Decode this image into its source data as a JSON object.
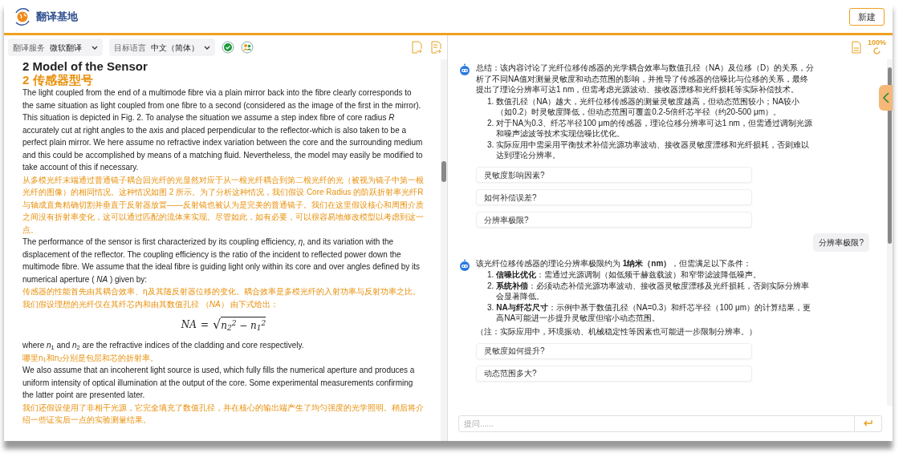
{
  "header": {
    "app_name": "翻译基地",
    "new_button": "新建"
  },
  "toolbar": {
    "selects": [
      {
        "label": "翻译服务",
        "value": "微软翻译"
      },
      {
        "label": "目标语言",
        "value": "中文（简体）"
      }
    ]
  },
  "document": {
    "blocks": [
      {
        "kind": "heading_source",
        "text": "2 Model of the Sensor"
      },
      {
        "kind": "heading_translation",
        "text": "2 传感器型号"
      },
      {
        "kind": "source",
        "text": "The light coupled from the end of a multimode fibre via a plain mirror back into the fibre clearly corresponds to the same situation as light coupled from one fibre to a second (considered as the image of the first in the mirror). This situation is depicted in Fig. 2. To analyse the situation we assume a step index fibre of core radius *R* accurately cut at right angles to the axis and placed perpendicular to the reflector-which is also taken to be a perfect plain mirror. We here assume no refractive index variation between the core and the surrounding medium and this could be accomplished by means of a matching fluid. Nevertheless, the model may easily be modified to take account of this if necessary."
      },
      {
        "kind": "translation",
        "text": "从多模光纤末端通过普通镜子耦合回光纤的光显然对应于从一根光纤耦合到第二根光纤的光（被视为镜子中第一根光纤的图像）的相同情况。这种情况如图 2 所示。为了分析这种情况，我们假设 Core Radius 的阶跃折射率光纤R与轴成直角精确切割并垂直于反射器放置——反射镜也被认为是完美的普通镜子。我们在这里假设核心和周围介质之间没有折射率变化，这可以通过匹配的流体来实现。尽管如此，如有必要，可以很容易地修改模型以考虑到这一点。"
      },
      {
        "kind": "source",
        "text": "The performance of the sensor is first characterized by its coupling efficiency, *η*, and its variation with the displacement of the reflector. The coupling efficiency is the ratio of the incident to reflected power down the multimode fibre. We assume that the ideal fibre is guiding light only within its core and over angles defined by its numerical aperture ( *NA* ) given by:"
      },
      {
        "kind": "translation",
        "text": "传感器的性能首先由其耦合效率、η及其随反射器位移的变化。耦合效率是多模光纤的入射功率与反射功率之比。我们假设理想的光纤仅在其纤芯内和由其数值孔径 （*NA*） 由下式给出："
      },
      {
        "kind": "formula",
        "lhs": "NA",
        "op": "=",
        "radical": "√",
        "radicand": "n$_{2}$$^{2}$ − n$_{1}$$^{2}$"
      },
      {
        "kind": "source",
        "text": "where *n*$_{1}$ and *n*$_{2}$ are the refractive indices of the cladding and core respectively."
      },
      {
        "kind": "translation",
        "text": "哪里n$_{1}$和n$_{2}$分别是包层和芯的折射率。"
      },
      {
        "kind": "source",
        "text": "We also assume that an incoherent light source is used, which fully fills the numerical aperture and produces a uniform intensity of optical illumination at the output of the core. Some experimental measurements confirming the latter point are presented later."
      },
      {
        "kind": "translation",
        "text": "我们还假设使用了非相干光源，它完全填充了数值孔径，并在核心的输出端产生了均匀强度的光学照明。稍后将介绍一些证实后一点的实验测量结果。"
      }
    ]
  },
  "chat": {
    "zoom": "100%",
    "messages": [
      {
        "kind": "bot",
        "intro": "总结：该内容讨论了光纤位移传感器的光学耦合效率与数值孔径（NA）及位移（D）的关系，分析了不同NA值对测量灵敏度和动态范围的影响，并推导了传感器的信噪比与位移的关系，最终提出了理论分辨率可达1 nm，但需考虑光源波动、接收器漂移和光纤损耗等实际补偿技术。",
        "items": [
          {
            "number": "1.",
            "text": "数值孔径（NA）越大，光纤位移传感器的测量灵敏度越高，但动态范围较小；NA较小（如0.2）时灵敏度降低，但动态范围可覆盖0.2-5倍纤芯半径（约20-500 μm）。"
          },
          {
            "number": "2.",
            "text": "对于NA为0.3、纤芯半径100 μm的传感器，理论位移分辨率可达1 nm，但需通过调制光源和噪声滤波等技术实现信噪比优化。"
          },
          {
            "number": "3.",
            "text": "实际应用中需采用平衡技术补偿光源功率波动、接收器灵敏度漂移和光纤损耗，否则难以达到理论分辨率。"
          }
        ]
      },
      {
        "kind": "suggestion",
        "text": "灵敏度影响因素?"
      },
      {
        "kind": "suggestion",
        "text": "如何补偿误差?"
      },
      {
        "kind": "suggestion",
        "text": "分辨率极限?"
      },
      {
        "kind": "user",
        "text": "分辨率极限?"
      },
      {
        "kind": "bot",
        "intro": "该光纤位移传感器的理论分辨率极限约为 **1纳米（nm）**，但需满足以下条件：",
        "items": [
          {
            "number": "1.",
            "text": "**信噪比优化**：需通过光源调制（如低频千赫兹载波）和窄带滤波降低噪声。"
          },
          {
            "number": "2.",
            "text": "**系统补偿**：必须动态补偿光源功率波动、接收器灵敏度漂移及光纤损耗，否则实际分辨率会显著降低。"
          },
          {
            "number": "3.",
            "text": "**NA与纤芯尺寸**：示例中基于数值孔径（NA=0.3）和纤芯半径（100 μm）的计算结果，更高NA可能进一步提升灵敏度但缩小动态范围。"
          }
        ],
        "note": "（注：实际应用中，环境振动、机械稳定性等因素也可能进一步限制分辨率。）"
      },
      {
        "kind": "suggestion",
        "text": "灵敏度如何提升?"
      },
      {
        "kind": "suggestion",
        "text": "动态范围多大?"
      }
    ],
    "input": {
      "placeholder": "提问......"
    }
  }
}
